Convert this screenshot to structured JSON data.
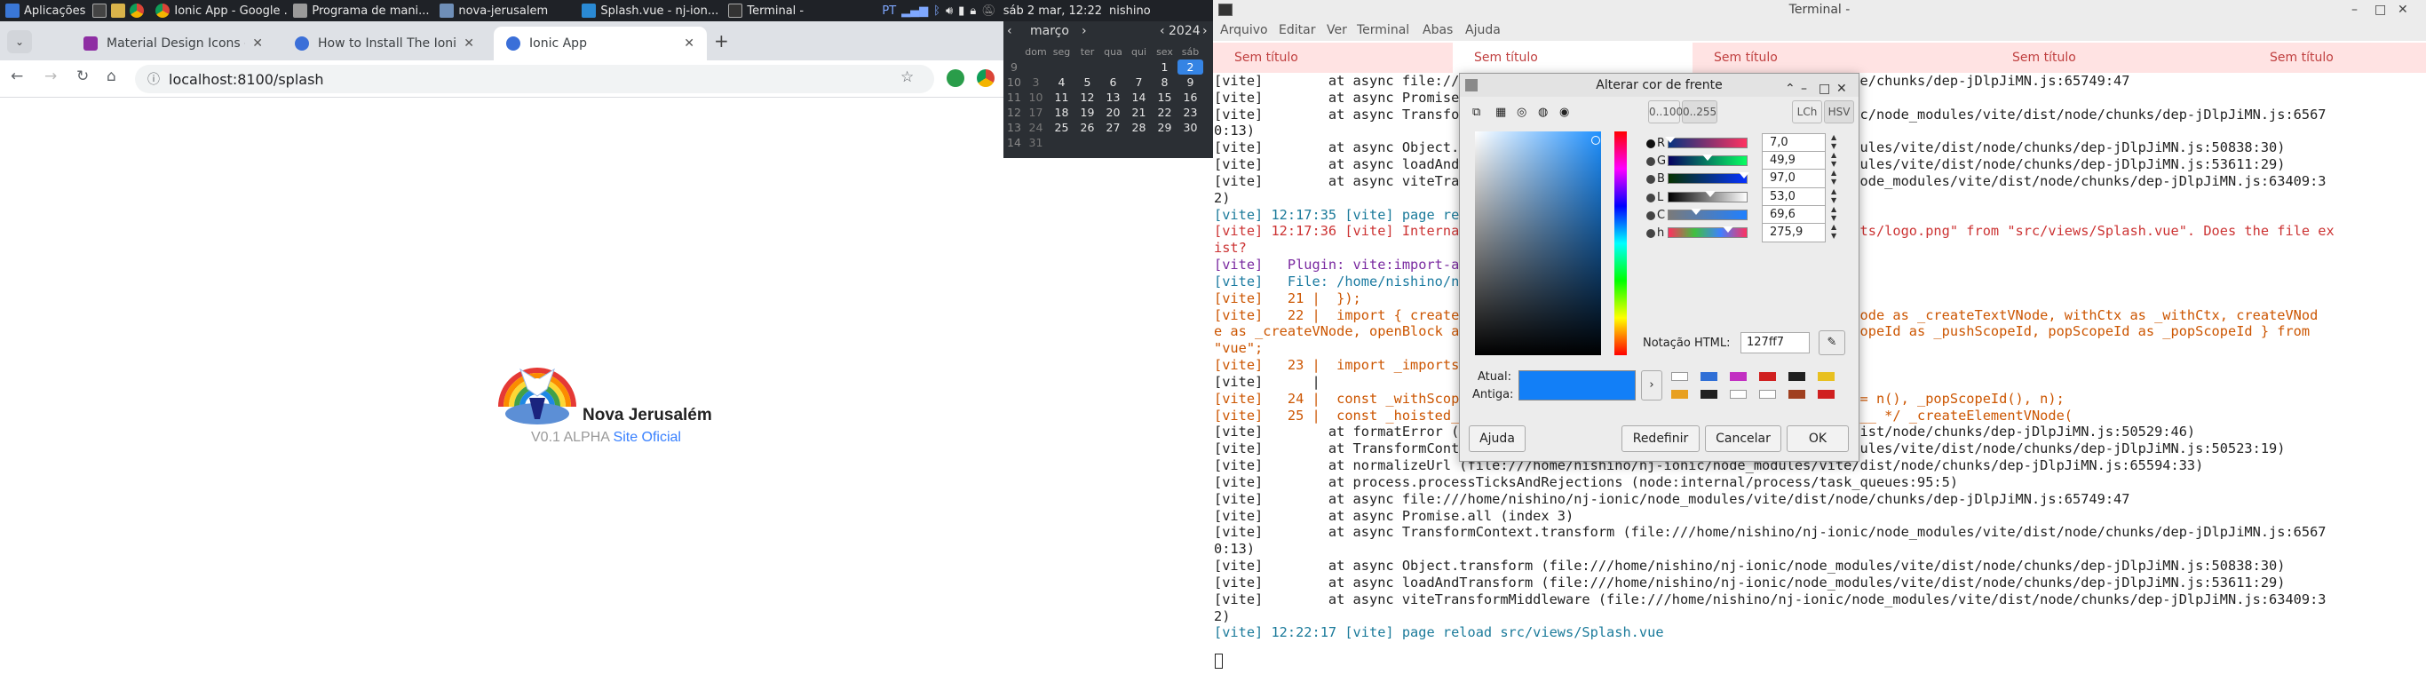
{
  "panel": {
    "apps_label": "Aplicações",
    "tasks": [
      "Ionic App - Google ...",
      "Programa de mani...",
      "nova-jerusalem",
      "Splash.vue - nj-ion...",
      "Terminal -"
    ],
    "lang": "PT",
    "clock": "sáb  2 mar, 12:22",
    "user": "nishino"
  },
  "browser": {
    "tabs": [
      {
        "title": "Material Design Icons - Ic",
        "color": "#8e2ea3"
      },
      {
        "title": "How to Install The Ionic F",
        "color": "#3b6fd8"
      },
      {
        "title": "Ionic App",
        "color": "#3b6fd8"
      }
    ],
    "url": "localhost:8100/splash",
    "new_tab": "+"
  },
  "page": {
    "app_name": "Nova Jerusalém",
    "version": "V0.1 ALPHA",
    "site_link": "Site Oficial"
  },
  "calendar": {
    "month": "março",
    "year": "2024",
    "day_headers": [
      "dom",
      "seg",
      "ter",
      "qua",
      "qui",
      "sex",
      "sáb"
    ],
    "weeks": [
      {
        "wk": "9",
        "days": [
          "",
          "",
          "",
          "",
          "",
          "1",
          "2"
        ]
      },
      {
        "wk": "10",
        "days": [
          "3",
          "4",
          "5",
          "6",
          "7",
          "8",
          "9"
        ]
      },
      {
        "wk": "11",
        "days": [
          "10",
          "11",
          "12",
          "13",
          "14",
          "15",
          "16"
        ]
      },
      {
        "wk": "12",
        "days": [
          "17",
          "18",
          "19",
          "20",
          "21",
          "22",
          "23"
        ]
      },
      {
        "wk": "13",
        "days": [
          "24",
          "25",
          "26",
          "27",
          "28",
          "29",
          "30"
        ]
      },
      {
        "wk": "14",
        "days": [
          "31",
          "",
          "",
          "",
          "",
          "",
          ""
        ]
      }
    ],
    "selected_day": "2"
  },
  "terminal": {
    "title": "Terminal -",
    "menu": [
      "Arquivo",
      "Editar",
      "Ver",
      "Terminal",
      "Abas",
      "Ajuda"
    ],
    "tabs": [
      "Sem título",
      "Sem título",
      "Sem título",
      "Sem título",
      "Sem título"
    ],
    "lines": [
      "[vite]        at async file:///home/nishino/nj-ionic/node_modules/vite/dist/node/chunks/dep-jDlpJiMN.js:65749:47",
      "[vite]        at async Promise.all (index 3)",
      "[vite]        at async TransformContext.transform (file:///home/nishino/nj-ionic/node_modules/vite/dist/node/chunks/dep-jDlpJiMN.js:6567",
      "0:13)",
      "[vite]        at async Object.transform (file:///home/nishino/nj-ionic/node_modules/vite/dist/node/chunks/dep-jDlpJiMN.js:50838:30)",
      "[vite]        at async loadAndTransform (file:///home/nishino/nj-ionic/node_modules/vite/dist/node/chunks/dep-jDlpJiMN.js:53611:29)",
      "[vite]        at async viteTransformMiddleware (file:///home/nishino/nj-ionic/node_modules/vite/dist/node/chunks/dep-jDlpJiMN.js:63409:3",
      "2)",
      "[vite] 12:17:35 [vite] page reload src/views/Splash.vue",
      "[vite] 12:17:36 [vite] Internal server error: Failed to resolve import \"../assets/logo.png\" from \"src/views/Splash.vue\". Does the file ex",
      "ist?",
      "[vite]   Plugin: vite:import-analysis",
      "[vite]   File: /home/nishino/nj-ionic/src/views/Splash.vue:22:36",
      "[vite]   21 |  });",
      "[vite]   22 |  import { createElementVNode as _createElementVNode, createTextVNode as _createTextVNode, withCtx as _withCtx, createVNod",
      "e as _createVNode, openBlock as _openBlock, createBlock as _createBlock, pushScopeId as _pushScopeId, popScopeId as _popScopeId } from",
      "\"vue\";",
      "[vite]   23 |  import _imports_0 from '../assets/logo.png'",
      "[vite]      |",
      "[vite]   24 |  const _withScopeId = (n) => (_pushScopeId(\"data-v-ab8d2a8c\"), n = n(), _popScopeId(), n);",
      "[vite]   25 |  const _hoisted_1 = /* @__PURE__ */ _withScopeId(() => /* @__PURE__ */ _createElementVNode(",
      "[vite]        at formatError (file:///home/nishino/nj-ionic/node_modules/vite/dist/node/chunks/dep-jDlpJiMN.js:50529:46)",
      "[vite]        at TransformContext.error (file:///home/nishino/nj-ionic/node_modules/vite/dist/node/chunks/dep-jDlpJiMN.js:50523:19)",
      "[vite]        at normalizeUrl (file:///home/nishino/nj-ionic/node_modules/vite/dist/node/chunks/dep-jDlpJiMN.js:65594:33)",
      "[vite]        at process.processTicksAndRejections (node:internal/process/task_queues:95:5)",
      "[vite]        at async file:///home/nishino/nj-ionic/node_modules/vite/dist/node/chunks/dep-jDlpJiMN.js:65749:47",
      "[vite]        at async Promise.all (index 3)",
      "[vite]        at async TransformContext.transform (file:///home/nishino/nj-ionic/node_modules/vite/dist/node/chunks/dep-jDlpJiMN.js:6567",
      "0:13)",
      "[vite]        at async Object.transform (file:///home/nishino/nj-ionic/node_modules/vite/dist/node/chunks/dep-jDlpJiMN.js:50838:30)",
      "[vite]        at async loadAndTransform (file:///home/nishino/nj-ionic/node_modules/vite/dist/node/chunks/dep-jDlpJiMN.js:53611:29)",
      "[vite]        at async viteTransformMiddleware (file:///home/nishino/nj-ionic/node_modules/vite/dist/node/chunks/dep-jDlpJiMN.js:63409:3",
      "2)",
      "[vite] 12:22:17 [vite] page reload src/views/Splash.vue"
    ]
  },
  "color_dialog": {
    "title": "Alterar cor de frente",
    "range_100": "0..100",
    "range_255": "0..255",
    "lch": "LCh",
    "hsv": "HSV",
    "channels": [
      {
        "label": "R",
        "value": "7,0",
        "fraction": 0.027
      },
      {
        "label": "G",
        "value": "49,9",
        "fraction": 0.499
      },
      {
        "label": "B",
        "value": "97,0",
        "fraction": 0.97
      },
      {
        "label": "L",
        "value": "53,0",
        "fraction": 0.53
      },
      {
        "label": "C",
        "value": "69,6",
        "fraction": 0.348
      },
      {
        "label": "h",
        "value": "275,9",
        "fraction": 0.766
      }
    ],
    "html_label": "Notação HTML:",
    "html_value": "127ff7",
    "current_label": "Atual:",
    "old_label": "Antiga:",
    "current_color": "#127ff7",
    "history_colors": [
      "#ffffff",
      "#2f6fd6",
      "#c22fc2",
      "#d02020",
      "#202020",
      "#e8c020",
      "#e8a020",
      "#202020",
      "#ffffff",
      "#ffffff",
      "#a04020",
      "#d02020"
    ],
    "help_button": "Ajuda",
    "reset_button": "Redefinir",
    "cancel_button": "Cancelar",
    "ok_button": "OK"
  }
}
